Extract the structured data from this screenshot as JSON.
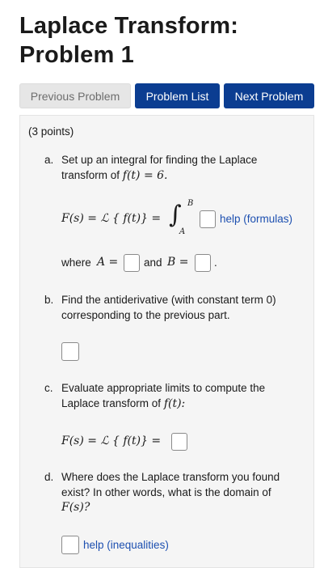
{
  "page": {
    "title_line1": "Laplace Transform:",
    "title_line2": "Problem 1"
  },
  "nav": {
    "previous_label": "Previous Problem",
    "list_label": "Problem List",
    "next_label": "Next Problem"
  },
  "problem": {
    "points": "(3 points)",
    "part_a": {
      "marker": "a.",
      "line1": "Set up an integral for finding the Laplace",
      "line2_text": "transform of ",
      "line2_math": "f(t) = 6.",
      "eq_lhs": "F(s) = ℒ { f(t)} =",
      "upper_limit": "B",
      "lower_limit": "A",
      "help_label": "help (formulas)",
      "where_text": "where ",
      "where_A": "A =",
      "and_text": "and ",
      "where_B": "B =",
      "period": "."
    },
    "part_b": {
      "marker": "b.",
      "line1": "Find the antiderivative (with constant term 0)",
      "line2": "corresponding to the previous part."
    },
    "part_c": {
      "marker": "c.",
      "line1": "Evaluate appropriate limits to compute the",
      "line2_text": "Laplace transform of ",
      "line2_math": "f(t):",
      "eq_lhs": "F(s) = ℒ { f(t)} ="
    },
    "part_d": {
      "marker": "d.",
      "line1": "Where does the Laplace transform you found",
      "line2": "exist? In other words, what is the domain of",
      "line3_math": "F(s)?",
      "help_label": "help (inequalities)"
    }
  }
}
